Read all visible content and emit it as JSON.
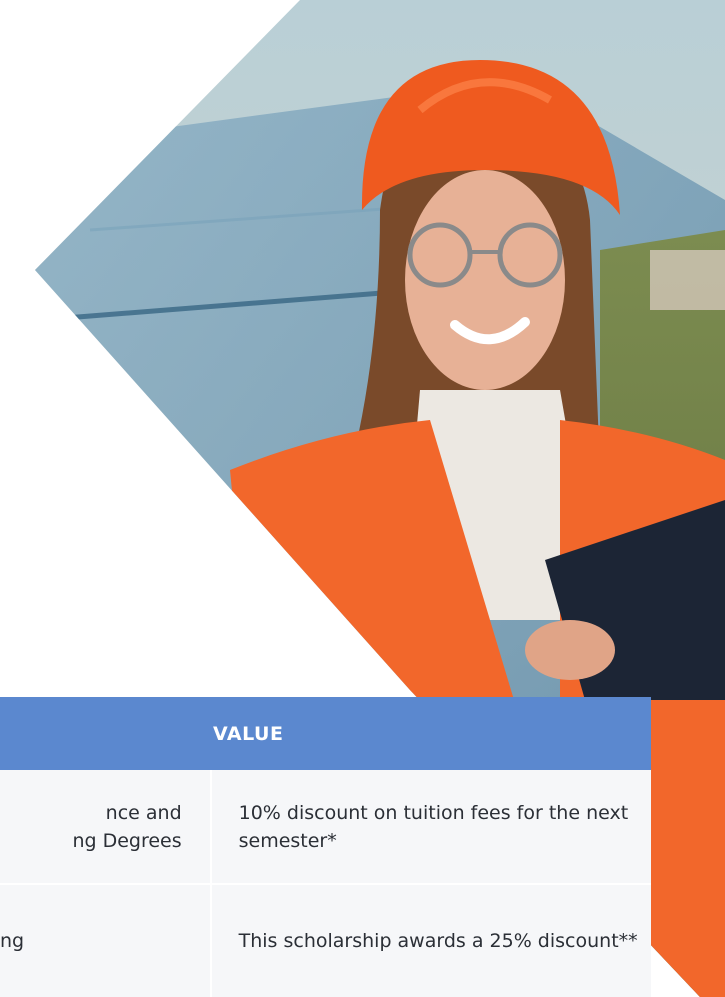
{
  "table": {
    "headers": [
      "",
      "VALUE"
    ],
    "rows": [
      {
        "col1": [
          "nce and",
          "ng Degrees"
        ],
        "col2": "10% discount on tuition fees for the next semester*"
      },
      {
        "col1": [
          "ng"
        ],
        "col2": "This scholarship awards a 25% discount**"
      }
    ]
  },
  "colors": {
    "header_bg": "#5b88cf",
    "row_bg": "#f6f7f9",
    "vest": "#f2672b",
    "helmet": "#ef5a1f"
  },
  "hero": {
    "icon": "photo-engineer-woman"
  }
}
